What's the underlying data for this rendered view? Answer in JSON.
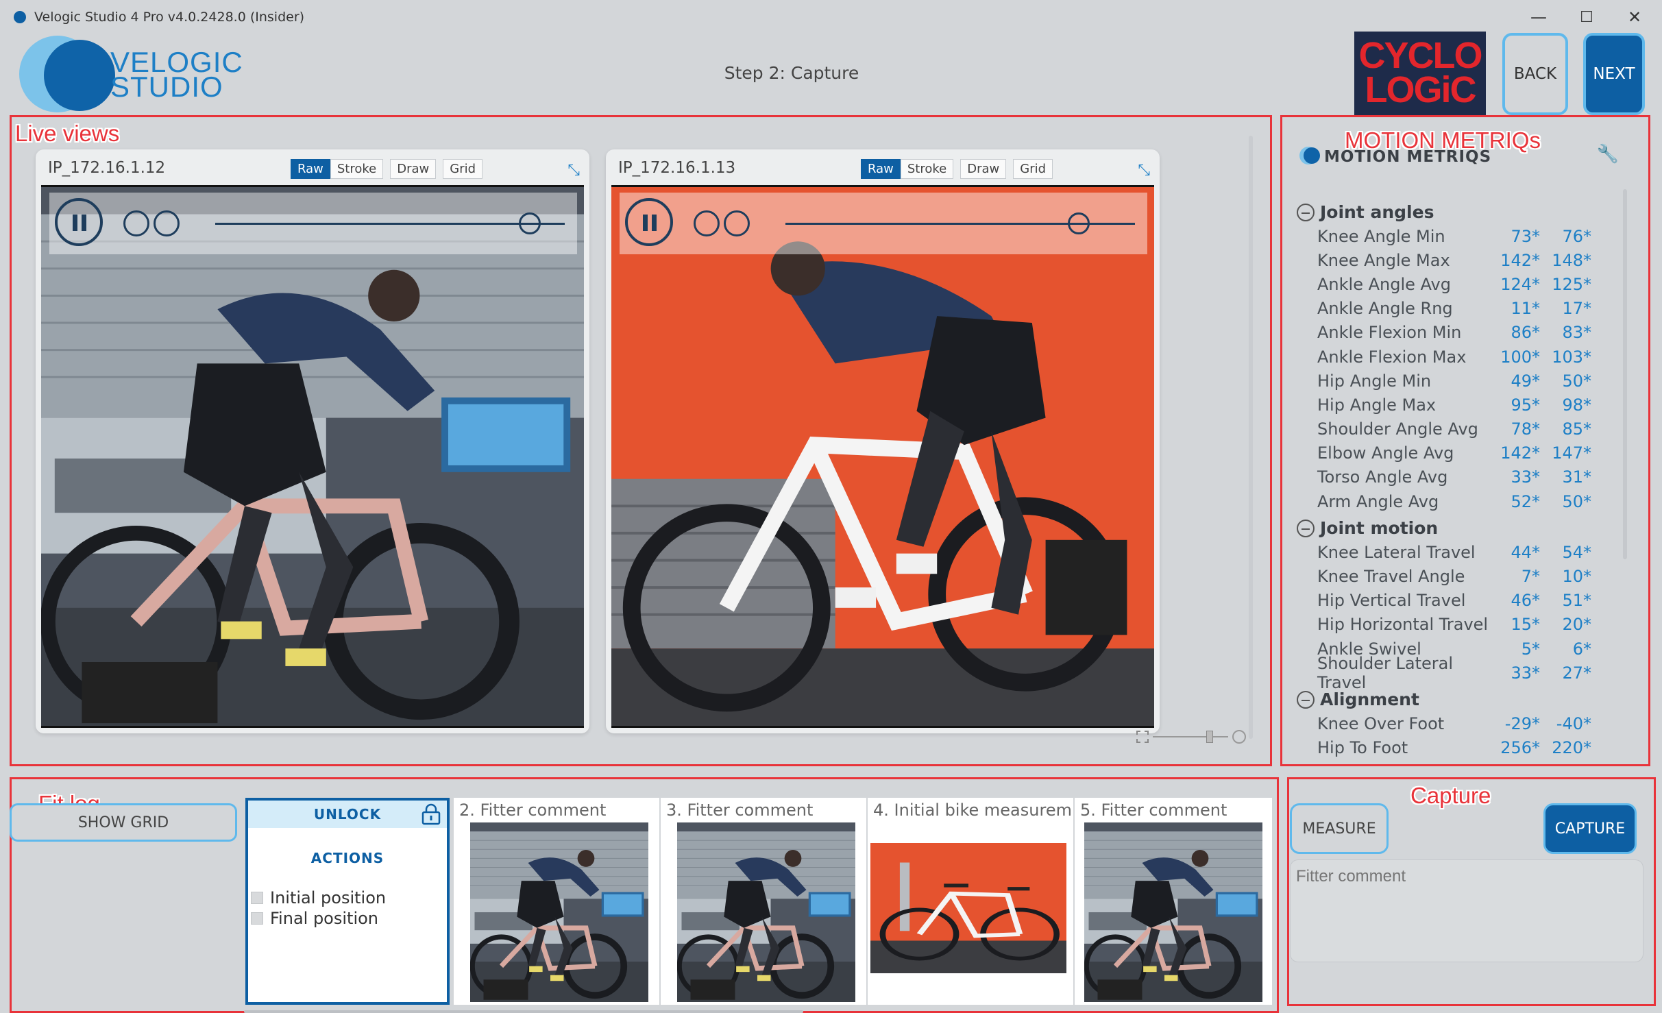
{
  "window": {
    "title": "Velogic Studio 4 Pro v4.0.2428.0 (Insider)",
    "minimize": "—",
    "maximize": "☐",
    "close": "✕"
  },
  "logo": {
    "line1": "VELOGIC",
    "line2": "STUDIO"
  },
  "header": {
    "step_title": "Step 2: Capture",
    "brand_line1": "CYCLO",
    "brand_line2": "LOGiC",
    "back_label": "BACK",
    "next_label": "NEXT"
  },
  "annotations": {
    "live_views": "Live views",
    "motion": "MOTION METRIQs",
    "fit_log": "Fit log",
    "capture": "Capture"
  },
  "cameras": [
    {
      "ip": "IP_172.16.1.12",
      "tabs": [
        "Raw",
        "Stroke",
        "Draw",
        "Grid"
      ],
      "active_tab": "Raw",
      "playback_position": 0.9
    },
    {
      "ip": "IP_172.16.1.13",
      "tabs": [
        "Raw",
        "Stroke",
        "Draw",
        "Grid"
      ],
      "active_tab": "Raw",
      "playback_position": 0.84
    }
  ],
  "metrics": {
    "title": "MOTION METRIQS",
    "groups": [
      {
        "name": "Joint angles",
        "rows": [
          {
            "name": "Knee Angle Min",
            "left": "73*",
            "right": "76*"
          },
          {
            "name": "Knee Angle Max",
            "left": "142*",
            "right": "148*"
          },
          {
            "name": "Ankle Angle Avg",
            "left": "124*",
            "right": "125*"
          },
          {
            "name": "Ankle Angle Rng",
            "left": "11*",
            "right": "17*"
          },
          {
            "name": "Ankle Flexion Min",
            "left": "86*",
            "right": "83*"
          },
          {
            "name": "Ankle Flexion Max",
            "left": "100*",
            "right": "103*"
          },
          {
            "name": "Hip Angle Min",
            "left": "49*",
            "right": "50*"
          },
          {
            "name": "Hip Angle Max",
            "left": "95*",
            "right": "98*"
          },
          {
            "name": "Shoulder Angle Avg",
            "left": "78*",
            "right": "85*"
          },
          {
            "name": "Elbow Angle Avg",
            "left": "142*",
            "right": "147*"
          },
          {
            "name": "Torso Angle Avg",
            "left": "33*",
            "right": "31*"
          },
          {
            "name": "Arm Angle Avg",
            "left": "52*",
            "right": "50*"
          }
        ]
      },
      {
        "name": "Joint motion",
        "rows": [
          {
            "name": "Knee Lateral Travel",
            "left": "44*",
            "right": "54*"
          },
          {
            "name": "Knee Travel Angle",
            "left": "7*",
            "right": "10*"
          },
          {
            "name": "Hip Vertical Travel",
            "left": "46*",
            "right": "51*"
          },
          {
            "name": "Hip Horizontal Travel",
            "left": "15*",
            "right": "20*"
          },
          {
            "name": "Ankle Swivel",
            "left": "5*",
            "right": "6*"
          },
          {
            "name": "Shoulder Lateral Travel",
            "left": "33*",
            "right": "27*"
          }
        ]
      },
      {
        "name": "Alignment",
        "rows": [
          {
            "name": "Knee Over Foot",
            "left": "-29*",
            "right": "-40*"
          },
          {
            "name": "Hip To Foot",
            "left": "256*",
            "right": "220*"
          }
        ]
      }
    ]
  },
  "fit_log": {
    "show_grid_label": "SHOW GRID",
    "unlock_label": "UNLOCK",
    "actions_label": "ACTIONS",
    "actions": [
      "Initial position",
      "Final position"
    ],
    "entries": [
      {
        "caption": "2. Fitter comment",
        "view": "rider-window"
      },
      {
        "caption": "3. Fitter comment",
        "view": "rider-window"
      },
      {
        "caption": "4. Initial bike measurem",
        "view": "bike-red-wall"
      },
      {
        "caption": "5. Fitter comment",
        "view": "rider-window"
      }
    ]
  },
  "capture": {
    "measure_label": "MEASURE",
    "capture_label": "CAPTURE",
    "comment_placeholder": "Fitter comment"
  },
  "colors": {
    "accent": "#0d5fa3",
    "highlight": "#5fb9ec",
    "annotation": "#e8333a",
    "value": "#1d7fc6"
  }
}
